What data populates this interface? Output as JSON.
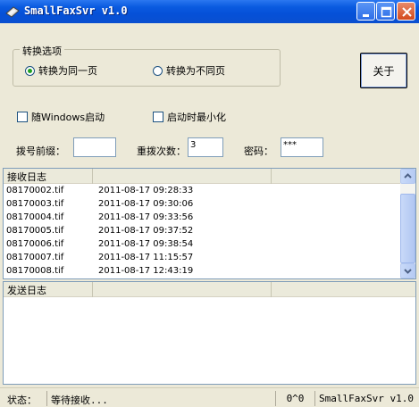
{
  "window": {
    "title": "SmallFaxSvr v1.0"
  },
  "options": {
    "group_title": "转换选项",
    "radio_same": "转换为同一页",
    "radio_diff": "转换为不同页",
    "about": "关于",
    "check_startup": "随Windows启动",
    "check_minimize": "启动时最小化",
    "dial_prefix_label": "拨号前缀：",
    "dial_prefix_value": "",
    "redial_label": "重拨次数：",
    "redial_value": "3",
    "password_label": "密码：",
    "password_value": "***"
  },
  "receive_log": {
    "header": "接收日志",
    "rows": [
      {
        "file": "08170002.tif",
        "time": "2011-08-17 09:28:33"
      },
      {
        "file": "08170003.tif",
        "time": "2011-08-17 09:30:06"
      },
      {
        "file": "08170004.tif",
        "time": "2011-08-17 09:33:56"
      },
      {
        "file": "08170005.tif",
        "time": "2011-08-17 09:37:52"
      },
      {
        "file": "08170006.tif",
        "time": "2011-08-17 09:38:54"
      },
      {
        "file": "08170007.tif",
        "time": "2011-08-17 11:15:57"
      },
      {
        "file": "08170008.tif",
        "time": "2011-08-17 12:43:19"
      }
    ]
  },
  "send_log": {
    "header": "发送日志"
  },
  "status": {
    "label": "状态：",
    "text": "等待接收...",
    "counter": "0^0",
    "version": "SmallFaxSvr v1.0"
  }
}
